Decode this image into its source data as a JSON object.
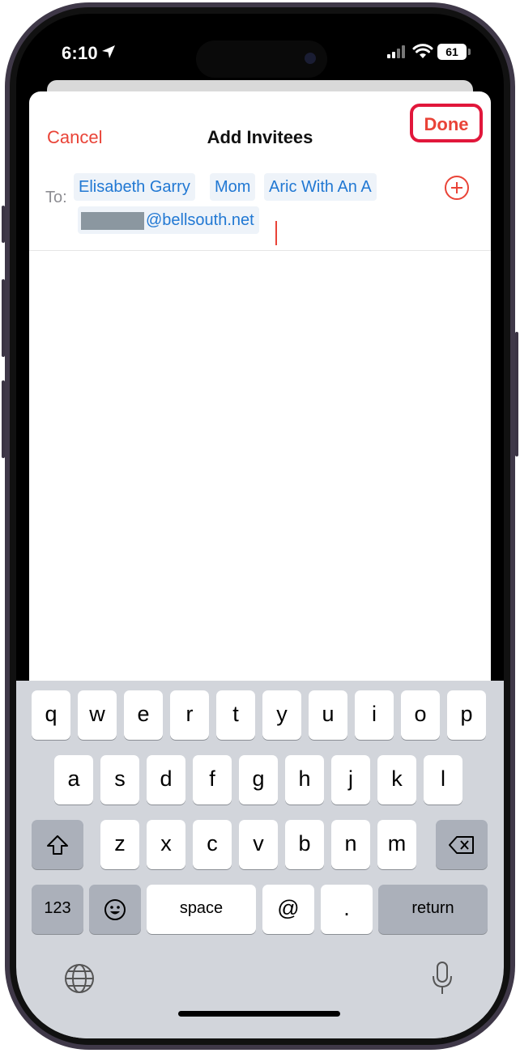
{
  "status": {
    "time": "6:10",
    "battery": "61"
  },
  "header": {
    "cancel_label": "Cancel",
    "title": "Add Invitees",
    "done_label": "Done"
  },
  "invitees": {
    "to_label": "To:",
    "tokens": [
      "Elisabeth Garry",
      "Mom",
      "Aric With An A"
    ],
    "email_suffix": "@bellsouth.net"
  },
  "keyboard": {
    "row1": [
      "q",
      "w",
      "e",
      "r",
      "t",
      "y",
      "u",
      "i",
      "o",
      "p"
    ],
    "row2": [
      "a",
      "s",
      "d",
      "f",
      "g",
      "h",
      "j",
      "k",
      "l"
    ],
    "row3": [
      "z",
      "x",
      "c",
      "v",
      "b",
      "n",
      "m"
    ],
    "numbers_label": "123",
    "space_label": "space",
    "at_label": "@",
    "period_label": ".",
    "return_label": "return"
  },
  "colors": {
    "accent": "#e94337",
    "token_text": "#2178d3",
    "highlight": "#e1173b"
  },
  "icons": [
    "location-arrow-icon",
    "signal-icon",
    "wifi-icon",
    "add-contact-icon",
    "shift-icon",
    "delete-icon",
    "emoji-icon",
    "globe-icon",
    "microphone-icon"
  ]
}
